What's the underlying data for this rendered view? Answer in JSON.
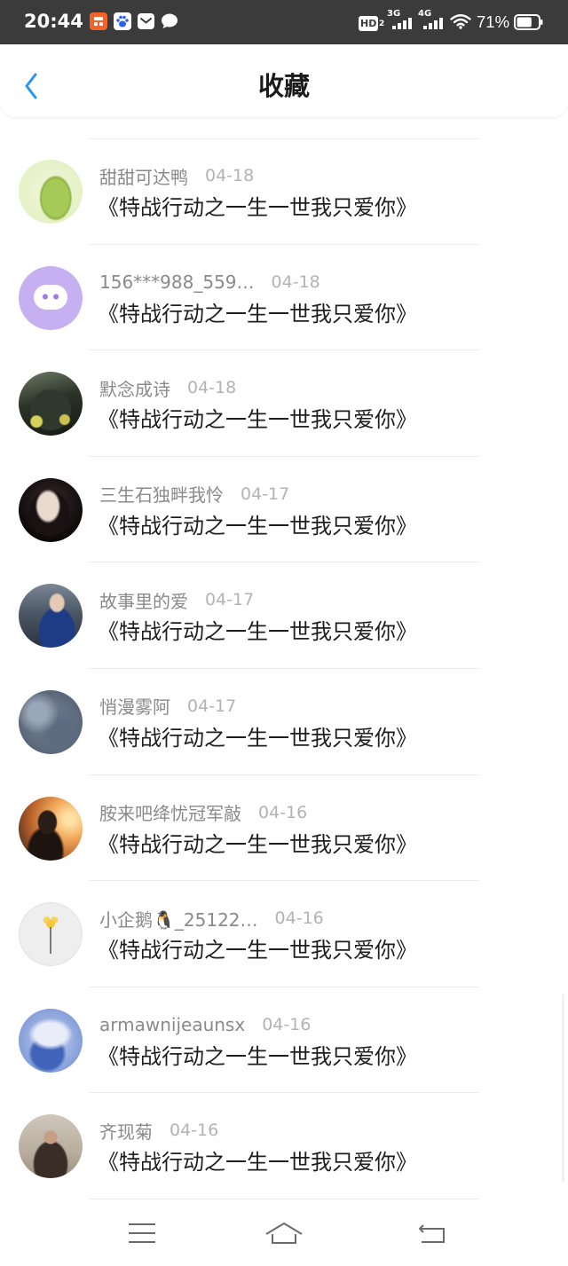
{
  "status_bar": {
    "time": "20:44",
    "notification_icons": [
      "app-store-icon",
      "baidu-paw-icon",
      "mail-icon",
      "chat-bubble-icon"
    ],
    "hd_label": "HD",
    "hd_subscript": "2",
    "sim1_network": "3G",
    "sim2_network": "4G",
    "battery_percent_label": "71%",
    "battery_level": 0.71,
    "icons": {
      "signal": "signal-bars-icon",
      "wifi": "wifi-icon",
      "battery": "battery-icon"
    }
  },
  "header": {
    "title": "收藏",
    "back_icon": "chevron-left-icon"
  },
  "colors": {
    "accent_blue": "#2b96ef",
    "status_bar_bg": "#3b3b3b",
    "name_gray": "#8a8a8a",
    "date_gray": "#b3b3b3",
    "title_text": "#1e1e1e"
  },
  "favorites": [
    {
      "user_name": "甜甜可达鸭",
      "date": "04-18",
      "work_title": "《特战行动之一生一世我只爱你》"
    },
    {
      "user_name": "156***988_559…",
      "date": "04-18",
      "work_title": "《特战行动之一生一世我只爱你》"
    },
    {
      "user_name": "默念成诗",
      "date": "04-18",
      "work_title": "《特战行动之一生一世我只爱你》"
    },
    {
      "user_name": "三生石独畔我怜",
      "date": "04-17",
      "work_title": "《特战行动之一生一世我只爱你》"
    },
    {
      "user_name": "故事里的爱",
      "date": "04-17",
      "work_title": "《特战行动之一生一世我只爱你》"
    },
    {
      "user_name": "悄漫雾阿",
      "date": "04-17",
      "work_title": "《特战行动之一生一世我只爱你》"
    },
    {
      "user_name": "胺来吧绛忧冠军敲",
      "date": "04-16",
      "work_title": "《特战行动之一生一世我只爱你》"
    },
    {
      "user_name": "小企鹅🐧_25122…",
      "date": "04-16",
      "work_title": "《特战行动之一生一世我只爱你》"
    },
    {
      "user_name": "armawnijeaunsx",
      "date": "04-16",
      "work_title": "《特战行动之一生一世我只爱你》"
    },
    {
      "user_name": "齐现菊",
      "date": "04-16",
      "work_title": "《特战行动之一生一世我只爱你》"
    }
  ],
  "bottom_nav": {
    "items": [
      "menu-icon",
      "home-icon",
      "back-icon"
    ]
  }
}
